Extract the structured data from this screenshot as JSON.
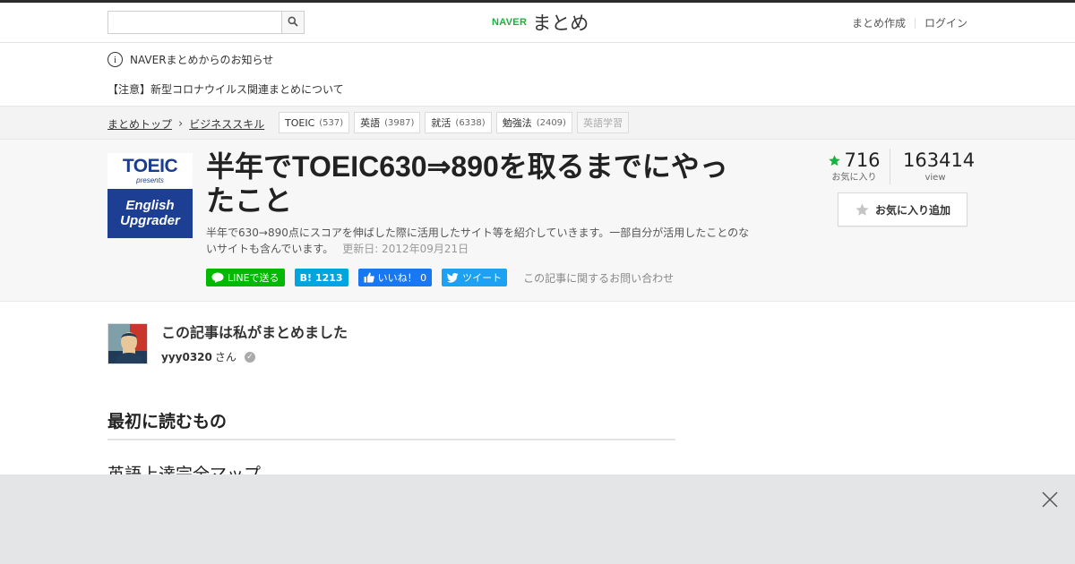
{
  "header": {
    "search_placeholder": "",
    "logo_brand": "NAVER",
    "logo_service": "まとめ",
    "links": [
      "まとめ作成",
      "ログイン"
    ]
  },
  "notice": {
    "heading": "NAVERまとめからのお知らせ",
    "item": "【注意】新型コロナウイルス関連まとめについて"
  },
  "breadcrumb": {
    "items": [
      "まとめトップ",
      "ビジネススキル"
    ]
  },
  "tags": [
    {
      "label": "TOEIC",
      "count": "(537)"
    },
    {
      "label": "英語",
      "count": "(3987)"
    },
    {
      "label": "就活",
      "count": "(6338)"
    },
    {
      "label": "勉強法",
      "count": "(2409)"
    },
    {
      "label": "英語学習",
      "count": ""
    }
  ],
  "article": {
    "thumb_toeic": "TOEIC",
    "thumb_presents": "presents",
    "thumb_line1": "English",
    "thumb_line2": "Upgrader",
    "title": "半年でTOEIC630⇒890を取るまでにやったこと",
    "description": "半年で630→890点にスコアを伸ばした際に活用したサイト等を紹介していきます。一部自分が活用したことのないサイトも含んでいます。",
    "updated": "更新日: 2012年09月21日",
    "favorites": "716",
    "favorites_label": "お気に入り",
    "views": "163414",
    "views_label": "view",
    "fav_button": "お気に入り追加",
    "contact": "この記事に関するお問い合わせ"
  },
  "share": {
    "line": "LINEで送る",
    "hatena": "1213",
    "facebook": "いいね！ 0",
    "twitter": "ツイート"
  },
  "author": {
    "heading": "この記事は私がまとめました",
    "name": "yyy0320",
    "suffix": "さん"
  },
  "content": {
    "section_title": "最初に読むもの",
    "next_title": "英語上達完全マップ"
  },
  "colors": {
    "accent_green": "#19b23f",
    "line_green": "#00b900",
    "hatena_blue": "#00a4de",
    "facebook_blue": "#1877f2",
    "twitter_blue": "#1da1f2",
    "overlay": "#e3e5e6"
  }
}
